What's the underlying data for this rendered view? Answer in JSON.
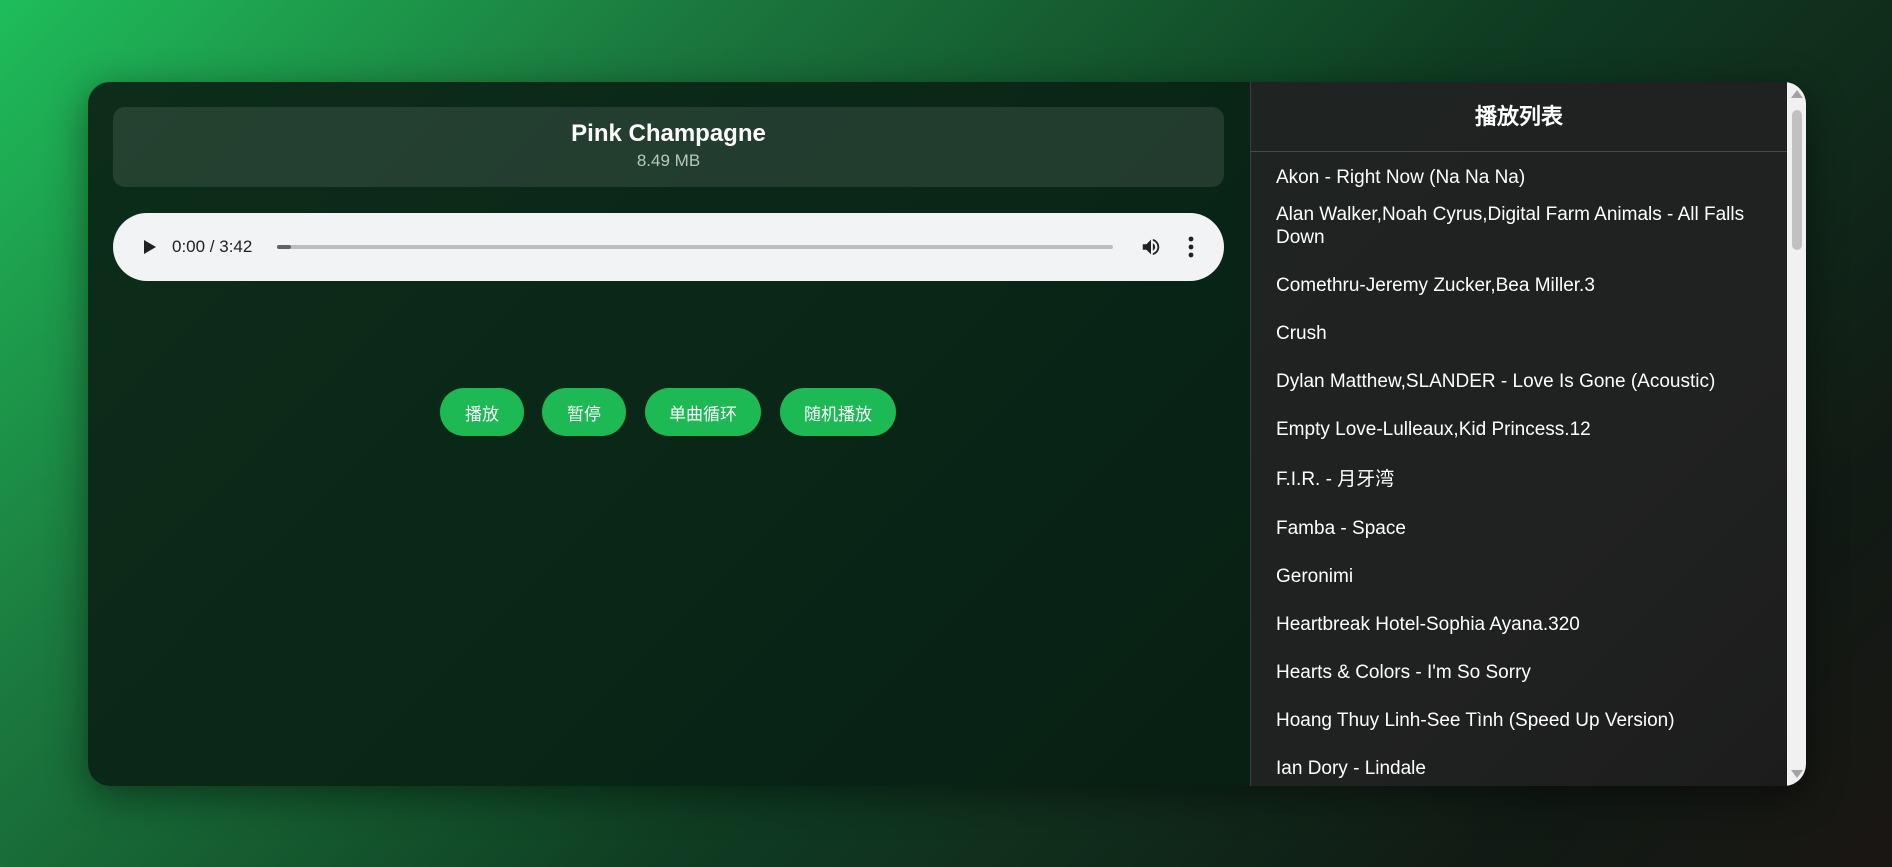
{
  "now_playing": {
    "title": "Pink Champagne",
    "size": "8.49 MB"
  },
  "audio_player": {
    "time": "0:00 / 3:42",
    "progress": 0.01,
    "play_icon": "play-icon",
    "volume_icon": "volume-icon",
    "more_icon": "more-vertical-icon"
  },
  "controls": {
    "play": "播放",
    "pause": "暂停",
    "loop_one": "单曲循环",
    "shuffle": "随机播放"
  },
  "playlist": {
    "title": "播放列表",
    "items": [
      "Akon - Right Now (Na Na Na)",
      "Alan Walker,Noah Cyrus,Digital Farm Animals - All Falls Down",
      "Comethru-Jeremy Zucker,Bea Miller.3",
      "Crush",
      "Dylan Matthew,SLANDER - Love Is Gone (Acoustic)",
      "Empty Love-Lulleaux,Kid Princess.12",
      "F.I.R. - 月牙湾",
      "Famba - Space",
      "Geronimi",
      "Heartbreak Hotel-Sophia Ayana.320",
      "Hearts & Colors - I'm So Sorry",
      "Hoang Thuy Linh-See Tình (Speed Up Version)",
      "Ian Dory - Lindale"
    ]
  },
  "colors": {
    "accent": "#1db954",
    "panel_dark": "#082416",
    "playlist_bg": "#202221"
  }
}
